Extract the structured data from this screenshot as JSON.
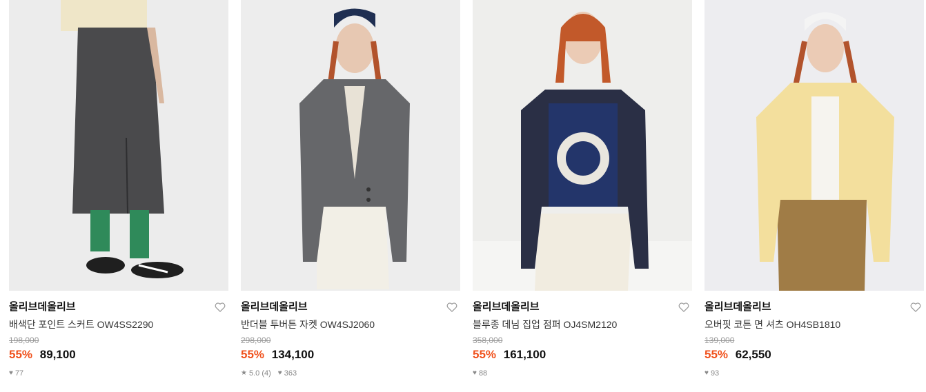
{
  "products": [
    {
      "brand": "올리브데올리브",
      "name": "배색단 포인트 스커트 OW4SS2290",
      "original_price": "198,000",
      "discount": "55%",
      "sale_price": "89,100",
      "rating": "",
      "likes": "77",
      "image_icon": "model-skirt-photo"
    },
    {
      "brand": "올리브데올리브",
      "name": "반더블 투버튼 자켓 OW4SJ2060",
      "original_price": "298,000",
      "discount": "55%",
      "sale_price": "134,100",
      "rating": "5.0 (4)",
      "likes": "363",
      "image_icon": "model-jacket-photo"
    },
    {
      "brand": "올리브데올리브",
      "name": "블루종 데님 집업 점퍼 OJ4SM2120",
      "original_price": "358,000",
      "discount": "55%",
      "sale_price": "161,100",
      "rating": "",
      "likes": "88",
      "image_icon": "model-denim-jumper-photo"
    },
    {
      "brand": "올리브데올리브",
      "name": "오버핏 코튼 면 셔츠 OH4SB1810",
      "original_price": "139,000",
      "discount": "55%",
      "sale_price": "62,550",
      "rating": "",
      "likes": "93",
      "image_icon": "model-shirt-photo"
    }
  ],
  "colors": {
    "discount": "#f0511c",
    "strike": "#999999",
    "meta": "#888888"
  }
}
